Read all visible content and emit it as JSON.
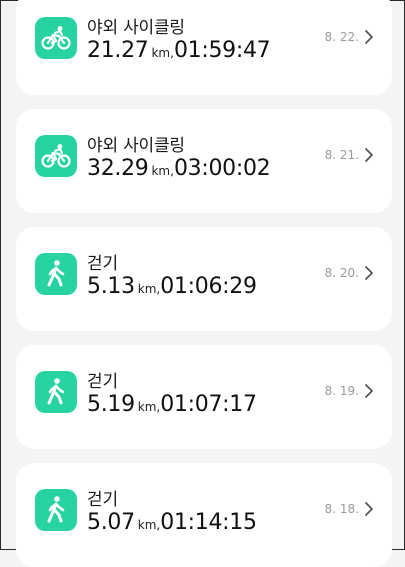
{
  "theme": {
    "accent": "#28d3a3",
    "card_bg": "#ffffff",
    "page_bg": "#f4f4f4"
  },
  "activities": [
    {
      "title": "야외 사이클링",
      "distance": "21.27",
      "unit": "km,",
      "duration": "01:59:47",
      "date": "8. 22.",
      "icon": "cycling-icon"
    },
    {
      "title": "야외 사이클링",
      "distance": "32.29",
      "unit": "km,",
      "duration": "03:00:02",
      "date": "8. 21.",
      "icon": "cycling-icon"
    },
    {
      "title": "걷기",
      "distance": "5.13",
      "unit": "km,",
      "duration": "01:06:29",
      "date": "8. 20.",
      "icon": "walking-icon"
    },
    {
      "title": "걷기",
      "distance": "5.19",
      "unit": "km,",
      "duration": "01:07:17",
      "date": "8. 19.",
      "icon": "walking-icon"
    },
    {
      "title": "걷기",
      "distance": "5.07",
      "unit": "km,",
      "duration": "01:14:15",
      "date": "8. 18.",
      "icon": "walking-icon"
    }
  ]
}
